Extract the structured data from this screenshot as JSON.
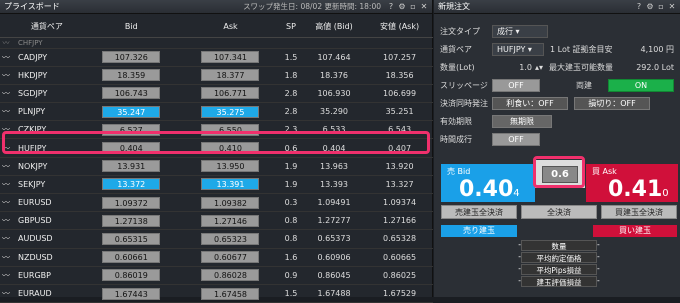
{
  "left": {
    "title": "プライスボード",
    "swap_info": "スワップ発生日: 08/02 更新時間: 18:00",
    "headers": [
      "通貨ペア",
      "Bid",
      "Ask",
      "SP",
      "高値 (Bid)",
      "安値 (Ask)"
    ],
    "partial_row": "CHFJPY",
    "rows": [
      {
        "pair": "CADJPY",
        "bid": "107.326",
        "ask": "107.341",
        "sp": "1.5",
        "high": "107.464",
        "low": "107.257",
        "bid_blue": false,
        "ask_blue": false
      },
      {
        "pair": "HKDJPY",
        "bid": "18.359",
        "ask": "18.377",
        "sp": "1.8",
        "high": "18.376",
        "low": "18.356",
        "bid_blue": false,
        "ask_blue": false
      },
      {
        "pair": "SGDJPY",
        "bid": "106.743",
        "ask": "106.771",
        "sp": "2.8",
        "high": "106.930",
        "low": "106.699",
        "bid_blue": false,
        "ask_blue": false
      },
      {
        "pair": "PLNJPY",
        "bid": "35.247",
        "ask": "35.275",
        "sp": "2.8",
        "high": "35.290",
        "low": "35.251",
        "bid_blue": true,
        "ask_blue": true
      },
      {
        "pair": "CZKJPY",
        "bid": "6.527",
        "ask": "6.550",
        "sp": "2.3",
        "high": "6.533",
        "low": "6.543",
        "bid_blue": false,
        "ask_blue": false
      },
      {
        "pair": "HUFJPY",
        "bid": "0.404",
        "ask": "0.410",
        "sp": "0.6",
        "high": "0.404",
        "low": "0.407",
        "bid_blue": false,
        "ask_blue": false
      },
      {
        "pair": "NOKJPY",
        "bid": "13.931",
        "ask": "13.950",
        "sp": "1.9",
        "high": "13.963",
        "low": "13.920",
        "bid_blue": false,
        "ask_blue": false
      },
      {
        "pair": "SEKJPY",
        "bid": "13.372",
        "ask": "13.391",
        "sp": "1.9",
        "high": "13.393",
        "low": "13.327",
        "bid_blue": true,
        "ask_blue": true
      },
      {
        "pair": "EURUSD",
        "bid": "1.09372",
        "ask": "1.09382",
        "sp": "0.3",
        "high": "1.09491",
        "low": "1.09374",
        "bid_blue": false,
        "ask_blue": false
      },
      {
        "pair": "GBPUSD",
        "bid": "1.27138",
        "ask": "1.27146",
        "sp": "0.8",
        "high": "1.27277",
        "low": "1.27166",
        "bid_blue": false,
        "ask_blue": false
      },
      {
        "pair": "AUDUSD",
        "bid": "0.65315",
        "ask": "0.65323",
        "sp": "0.8",
        "high": "0.65373",
        "low": "0.65328",
        "bid_blue": false,
        "ask_blue": false
      },
      {
        "pair": "NZDUSD",
        "bid": "0.60661",
        "ask": "0.60677",
        "sp": "1.6",
        "high": "0.60906",
        "low": "0.60665",
        "bid_blue": false,
        "ask_blue": false
      },
      {
        "pair": "EURGBP",
        "bid": "0.86019",
        "ask": "0.86028",
        "sp": "0.9",
        "high": "0.86045",
        "low": "0.86025",
        "bid_blue": false,
        "ask_blue": false
      },
      {
        "pair": "EURAUD",
        "bid": "1.67443",
        "ask": "1.67458",
        "sp": "1.5",
        "high": "1.67488",
        "low": "1.67529",
        "bid_blue": false,
        "ask_blue": false
      }
    ]
  },
  "right": {
    "title": "新規注文",
    "order_type_label": "注文タイプ",
    "order_type": "成行",
    "pair_label": "通貨ペア",
    "pair": "HUFJPY",
    "margin_label": "1 Lot 証拠金目安",
    "margin_value": "4,100 円",
    "lot_label": "数量(Lot)",
    "lot_value": "1.0",
    "max_label": "最大建玉可能数量",
    "max_value": "292.0 Lot",
    "slip_label": "スリッページ",
    "slip_value": "OFF",
    "ryodate_label": "両建",
    "ryodate_value": "ON",
    "settle_label": "決済同時発注",
    "take_profit": "利食い：OFF",
    "stop_loss": "損切り：OFF",
    "expiry_label": "有効期限",
    "expiry_value": "無期限",
    "time_label": "時間成行",
    "time_value": "OFF",
    "bid_label": "売 Bid",
    "bid_big": "0.40",
    "bid_small": "4",
    "ask_label": "買 Ask",
    "ask_big": "0.41",
    "ask_small": "0",
    "spread": "0.6",
    "sell_all": "売建玉全決済",
    "all": "全決済",
    "buy_all": "買建玉全決済",
    "sell_pos": "売り建玉",
    "buy_pos": "買い建玉",
    "summary": [
      {
        "label": "数量",
        "l": "-",
        "r": "-"
      },
      {
        "label": "平均約定価格",
        "l": "-",
        "r": "-"
      },
      {
        "label": "平均Pips損益",
        "l": "-",
        "r": "-"
      },
      {
        "label": "建玉評価損益",
        "l": "-",
        "r": "-"
      }
    ]
  }
}
